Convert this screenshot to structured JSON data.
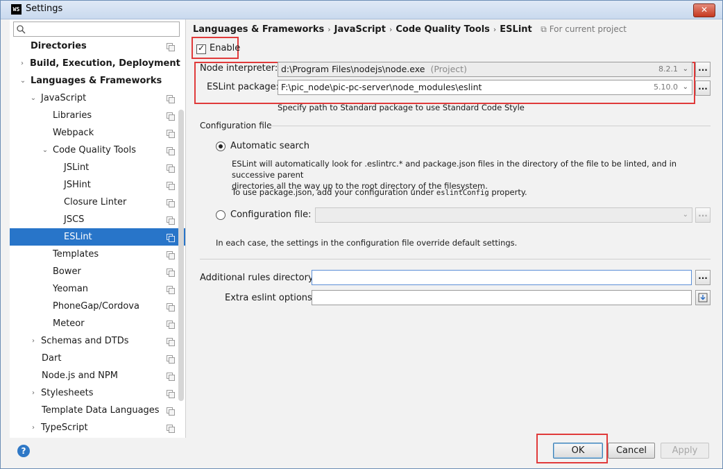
{
  "window": {
    "app_icon_text": "WS",
    "title": "Settings",
    "close_label": "✕"
  },
  "sidebar": {
    "search": {
      "placeholder": "",
      "value": ""
    },
    "items": [
      {
        "label": "Directories",
        "bold": true
      },
      {
        "label": "Build, Execution, Deployment",
        "bold": true
      },
      {
        "label": "Languages & Frameworks",
        "bold": true
      },
      {
        "label": "JavaScript"
      },
      {
        "label": "Libraries"
      },
      {
        "label": "Webpack"
      },
      {
        "label": "Code Quality Tools"
      },
      {
        "label": "JSLint"
      },
      {
        "label": "JSHint"
      },
      {
        "label": "Closure Linter"
      },
      {
        "label": "JSCS"
      },
      {
        "label": "ESLint",
        "selected": true
      },
      {
        "label": "Templates"
      },
      {
        "label": "Bower"
      },
      {
        "label": "Yeoman"
      },
      {
        "label": "PhoneGap/Cordova"
      },
      {
        "label": "Meteor"
      },
      {
        "label": "Schemas and DTDs"
      },
      {
        "label": "Dart"
      },
      {
        "label": "Node.js and NPM"
      },
      {
        "label": "Stylesheets"
      },
      {
        "label": "Template Data Languages"
      },
      {
        "label": "TypeScript"
      }
    ]
  },
  "breadcrumb": {
    "parts": [
      "Languages & Frameworks",
      "JavaScript",
      "Code Quality Tools",
      "ESLint"
    ],
    "separator": "›",
    "scope": "For current project"
  },
  "enable": {
    "label": "Enable",
    "checked": true
  },
  "node_interpreter": {
    "label": "Node interpreter:",
    "value": "d:\\Program Files\\nodejs\\node.exe",
    "suffix": "(Project)",
    "version": "8.2.1"
  },
  "eslint_package": {
    "label": "ESLint package:",
    "value": "F:\\pic_node\\pic-pc-server\\node_modules\\eslint",
    "version": "5.10.0"
  },
  "standard_hint": "Specify path to Standard package to use Standard Code Style",
  "config": {
    "section_title": "Configuration file",
    "automatic_label": "Automatic search",
    "automatic_desc_1": "ESLint will automatically look for .eslintrc.* and package.json files in the directory of the file to be linted, and in successive parent",
    "automatic_desc_2": "directories all the way up to the root directory of the filesystem.",
    "package_json_pre": "To use package.json, add your configuration under",
    "package_json_code": "eslintConfig",
    "package_json_post": "property.",
    "config_file_label": "Configuration file:",
    "override_note": "In each case, the settings in the configuration file override default settings."
  },
  "additional_rules": {
    "label": "Additional rules directory:",
    "value": ""
  },
  "extra_options": {
    "label": "Extra eslint options:",
    "value": ""
  },
  "buttons": {
    "browse": "...",
    "help": "?",
    "ok": "OK",
    "cancel": "Cancel",
    "apply": "Apply"
  }
}
